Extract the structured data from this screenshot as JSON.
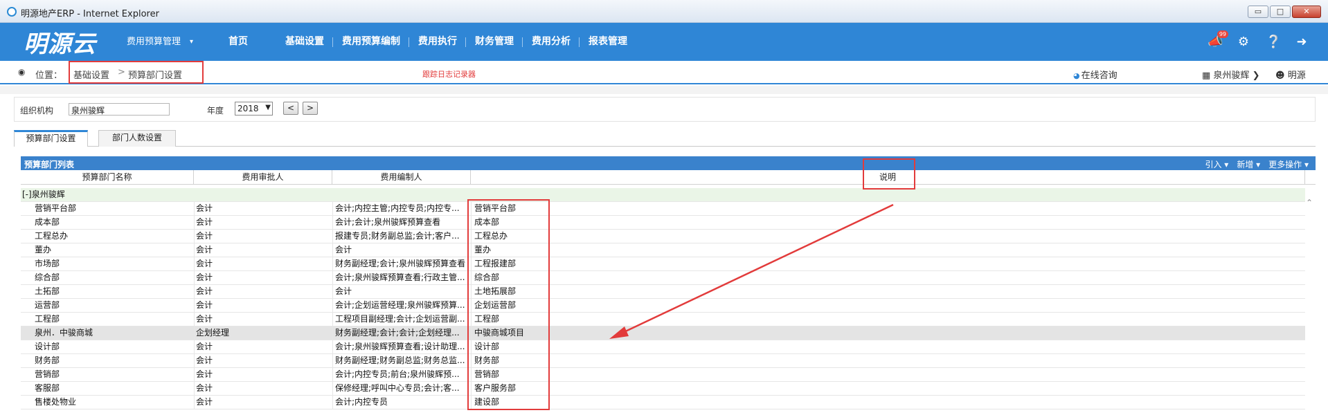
{
  "window": {
    "title": "明源地产ERP - Internet Explorer",
    "controls": {
      "minimize": "▭",
      "maximize": "□",
      "close": "✕"
    }
  },
  "nav": {
    "logo": "明源云",
    "menu_dropdown": "费用预算管理",
    "items": [
      "首页",
      "基础设置",
      "费用预算编制",
      "费用执行",
      "财务管理",
      "费用分析",
      "报表管理"
    ],
    "icons": [
      "megaphone-icon",
      "gear-icon",
      "help-icon",
      "logout-icon"
    ],
    "badge": "99"
  },
  "breadcrumb": {
    "label": "位置：",
    "level1": "基础设置",
    "separator": ">",
    "level2": "预算部门设置",
    "tracker": "跟踪日志记录器",
    "consult": "在线咨询",
    "org": "泉州骏辉",
    "user": "明源"
  },
  "filter": {
    "org_label": "组织机构",
    "org_value": "泉州骏辉",
    "year_label": "年度",
    "year_value": "2018",
    "prev": "<",
    "next": ">"
  },
  "tabs": [
    {
      "label": "预算部门设置",
      "active": true
    },
    {
      "label": "部门人数设置",
      "active": false
    }
  ],
  "grid": {
    "title": "预算部门列表",
    "actions": [
      "引入 ▾",
      "新增 ▾",
      "更多操作 ▾"
    ],
    "columns": [
      "预算部门名称",
      "费用审批人",
      "费用编制人",
      "说明"
    ],
    "group": "[-]泉州骏辉",
    "rows": [
      [
        "营销平台部",
        "会计",
        "会计;内控主管;内控专员;内控专...",
        "营销平台部"
      ],
      [
        "成本部",
        "会计",
        "会计;会计;泉州骏辉预算查看",
        "成本部"
      ],
      [
        "工程总办",
        "会计",
        "报建专员;财务副总监;会计;客户...",
        "工程总办"
      ],
      [
        "董办",
        "会计",
        "会计",
        "董办"
      ],
      [
        "市场部",
        "会计",
        "财务副经理;会计;泉州骏辉预算查看",
        "工程报建部"
      ],
      [
        "综合部",
        "会计",
        "会计;泉州骏辉预算查看;行政主管...",
        "综合部"
      ],
      [
        "土拓部",
        "会计",
        "会计",
        "土地拓展部"
      ],
      [
        "运营部",
        "会计",
        "会计;企划运营经理;泉州骏辉预算...",
        "企划运营部"
      ],
      [
        "工程部",
        "会计",
        "工程项目副经理;会计;企划运营副...",
        "工程部"
      ],
      [
        "泉州．中骏商城",
        "企划经理",
        "财务副经理;会计;会计;企划经理...",
        "中骏商城项目"
      ],
      [
        "设计部",
        "会计",
        "会计;泉州骏辉预算查看;设计助理...",
        "设计部"
      ],
      [
        "财务部",
        "会计",
        "财务副经理;财务副总监;财务总监...",
        "财务部"
      ],
      [
        "营销部",
        "会计",
        "会计;内控专员;前台;泉州骏辉预...",
        "营销部"
      ],
      [
        "客服部",
        "会计",
        "保修经理;呼叫中心专员;会计;客...",
        "客户服务部"
      ],
      [
        "售楼处物业",
        "会计",
        "会计;内控专员",
        "建设部"
      ]
    ],
    "selected_row": 9
  },
  "colors": {
    "brand_blue": "#2f86d6",
    "grid_header": "#3a82cc",
    "annotation_red": "#e23b3b",
    "group_row": "#eaf5e7"
  }
}
